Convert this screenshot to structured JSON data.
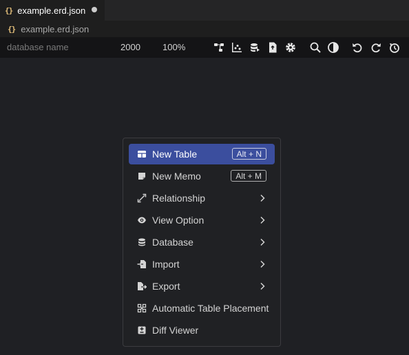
{
  "tab": {
    "title": "example.erd.json",
    "icon": "curly-braces-json-icon",
    "icon_glyph": "{}",
    "unsaved": true
  },
  "breadcrumb": {
    "file": "example.erd.json",
    "icon_glyph": "{}"
  },
  "toolbar": {
    "database_name_placeholder": "database name",
    "canvas_width": "2000",
    "zoom": "100%",
    "icons": [
      "relationship-tree-icon",
      "visualization-chart-icon",
      "database-import-icon",
      "export-file-icon",
      "settings-gear-icon",
      "search-icon",
      "theme-contrast-icon",
      "undo-icon",
      "redo-icon",
      "history-icon"
    ]
  },
  "context_menu": {
    "items": [
      {
        "label": "New Table",
        "shortcut": "Alt + N",
        "icon": "table-icon"
      },
      {
        "label": "New Memo",
        "shortcut": "Alt + M",
        "icon": "memo-icon"
      },
      {
        "label": "Relationship",
        "icon": "relationship-icon"
      },
      {
        "label": "View Option",
        "icon": "eye-icon"
      },
      {
        "label": "Database",
        "icon": "database-icon"
      },
      {
        "label": "Import",
        "icon": "import-icon"
      },
      {
        "label": "Export",
        "icon": "export-icon"
      },
      {
        "label": "Automatic Table Placement",
        "icon": "auto-placement-icon"
      },
      {
        "label": "Diff Viewer",
        "icon": "diff-icon"
      }
    ]
  },
  "colors": {
    "editor_bg": "#1f2024",
    "toolbar_bg": "#141416",
    "menu_highlight": "#3b4e9e",
    "json_icon": "#e5c07b"
  }
}
